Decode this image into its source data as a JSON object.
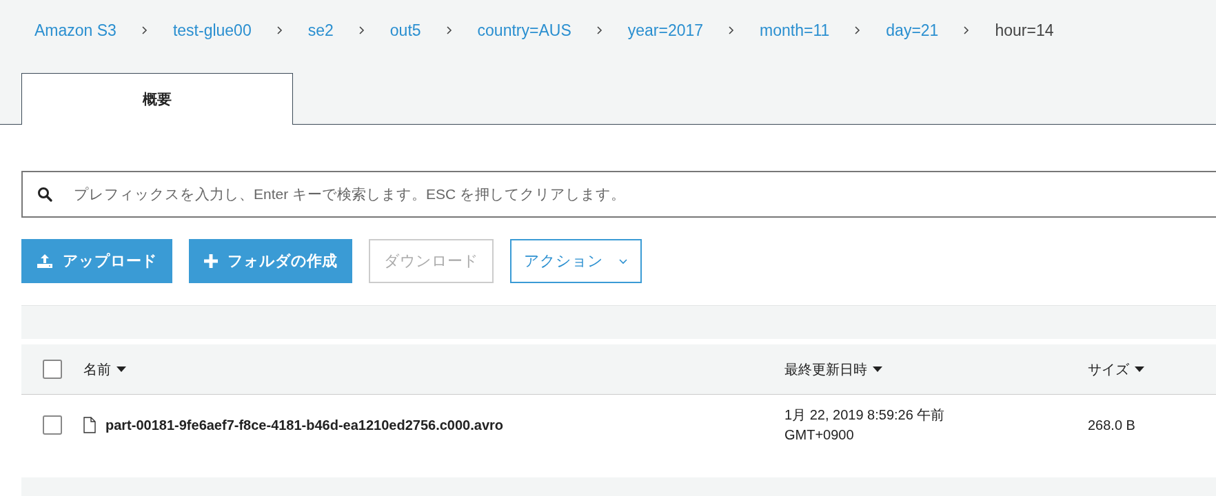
{
  "breadcrumb": [
    {
      "label": "Amazon S3",
      "current": false
    },
    {
      "label": "test-glue00",
      "current": false
    },
    {
      "label": "se2",
      "current": false
    },
    {
      "label": "out5",
      "current": false
    },
    {
      "label": "country=AUS",
      "current": false
    },
    {
      "label": "year=2017",
      "current": false
    },
    {
      "label": "month=11",
      "current": false
    },
    {
      "label": "day=21",
      "current": false
    },
    {
      "label": "hour=14",
      "current": true
    }
  ],
  "tabs": [
    {
      "label": "概要",
      "selected": true
    }
  ],
  "search": {
    "placeholder": "プレフィックスを入力し、Enter キーで検索します。ESC を押してクリアします。"
  },
  "buttons": [
    {
      "label": "アップロード",
      "kind": "upload",
      "disabled": false
    },
    {
      "label": "フォルダの作成",
      "kind": "create",
      "disabled": false
    },
    {
      "label": "ダウンロード",
      "kind": "plain",
      "disabled": true
    },
    {
      "label": "アクション",
      "kind": "dropdown",
      "disabled": false
    }
  ],
  "table": {
    "select_all": {
      "checked": false
    },
    "columns": [
      "名前",
      "最終更新日時",
      "サイズ"
    ],
    "rows": [
      {
        "checked": false,
        "name": "part-00181-9fe6aef7-f8ce-4181-b46d-ea1210ed2756.c000.avro",
        "modified": "1月 22, 2019 8:59:26 午前\nGMT+0900",
        "size": "268.0 B"
      }
    ]
  }
}
